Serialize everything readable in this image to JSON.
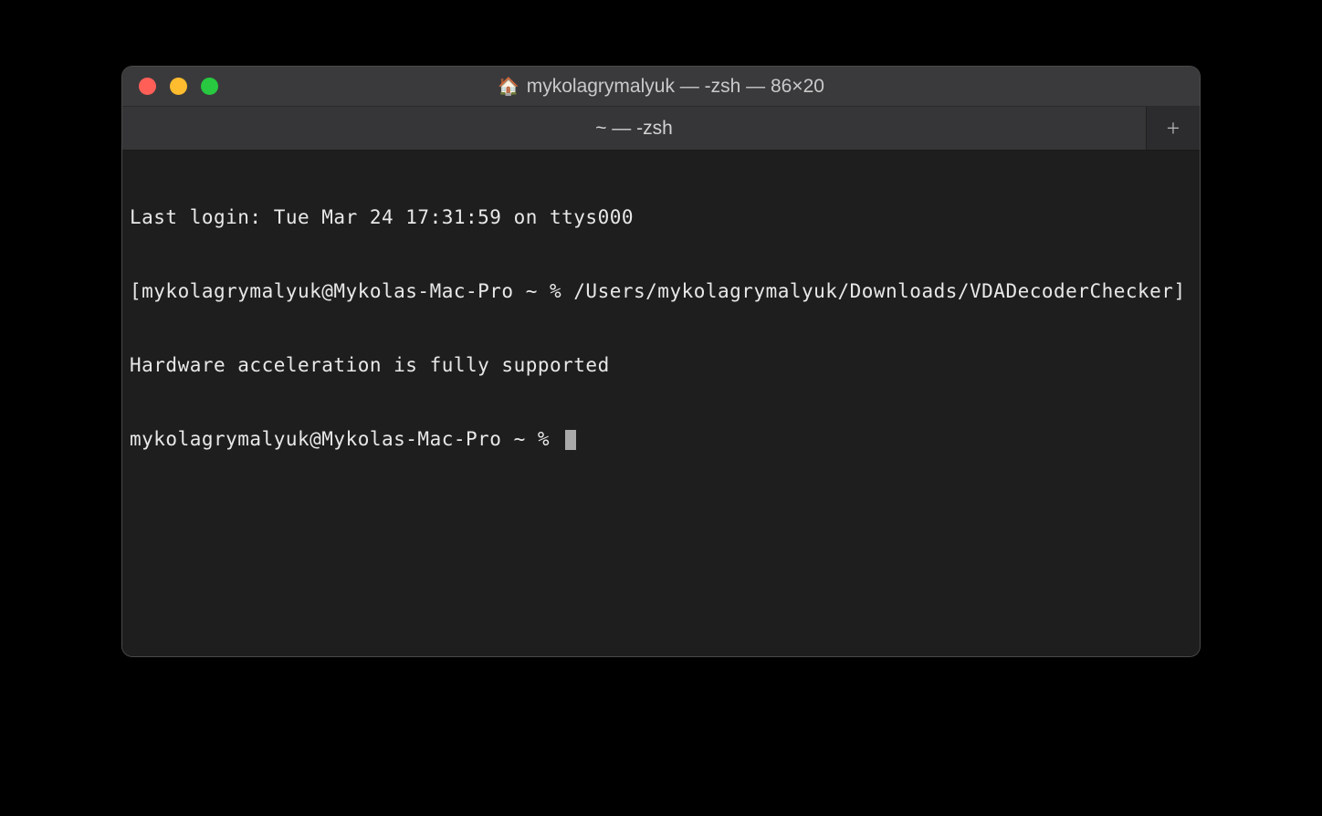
{
  "window": {
    "title_icon": "home-icon",
    "title": "mykolagrymalyuk — -zsh — 86×20"
  },
  "tabs": {
    "active_label": "~ — -zsh",
    "new_tab_symbol": "+"
  },
  "terminal": {
    "lines": {
      "login": "Last login: Tue Mar 24 17:31:59 on ttys000",
      "cmd": "[mykolagrymalyuk@Mykolas-Mac-Pro ~ % /Users/mykolagrymalyuk/Downloads/VDADecoderChecker]",
      "output": "Hardware acceleration is fully supported",
      "prompt": "mykolagrymalyuk@Mykolas-Mac-Pro ~ % "
    }
  }
}
